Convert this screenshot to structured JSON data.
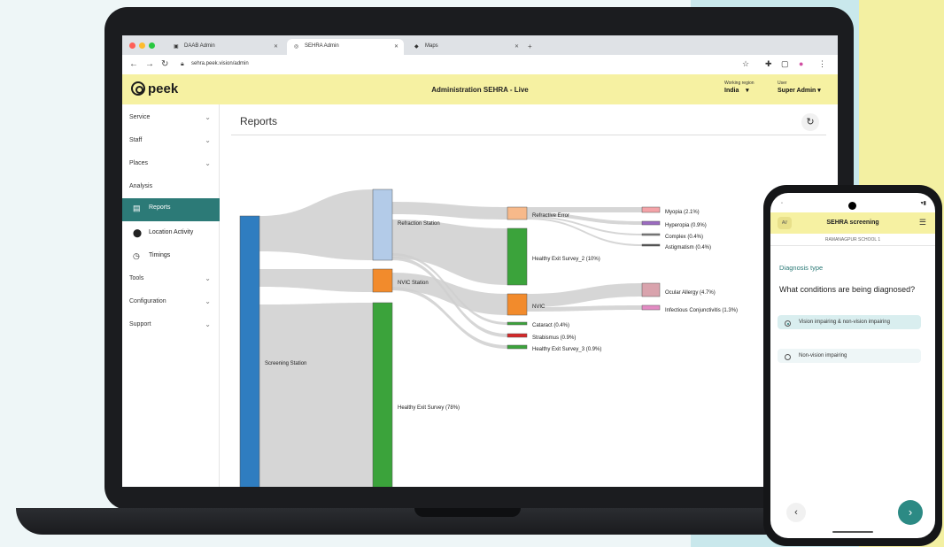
{
  "browser": {
    "tabs": [
      {
        "label": "DAAB Admin",
        "icon": "tab-favicon"
      },
      {
        "label": "SEHRA Admin",
        "icon": "peek-favicon"
      },
      {
        "label": "Maps",
        "icon": "figma-favicon"
      }
    ],
    "url": "sehra.peek.vision/admin"
  },
  "header": {
    "logo": "peek",
    "title": "Administration SEHRA - Live",
    "region_label": "Working region",
    "region_value": "India",
    "user_label": "User",
    "user_value": "Super Admin"
  },
  "sidebar": {
    "items": [
      {
        "label": "Service",
        "expandable": true
      },
      {
        "label": "Staff",
        "expandable": true
      },
      {
        "label": "Places",
        "expandable": true
      },
      {
        "label": "Analysis",
        "expandable": false
      },
      {
        "label": "Reports",
        "icon": "report-icon",
        "active": true
      },
      {
        "label": "Location Activity",
        "icon": "pin-icon"
      },
      {
        "label": "Timings",
        "icon": "timer-icon"
      },
      {
        "label": "Tools",
        "expandable": true
      },
      {
        "label": "Configuration",
        "expandable": true
      },
      {
        "label": "Support",
        "expandable": true
      }
    ]
  },
  "main": {
    "title": "Reports"
  },
  "chart_data": {
    "type": "sankey",
    "nodes": [
      {
        "id": "screening",
        "label": "Screening Station",
        "color": "#2f7dc0"
      },
      {
        "id": "refraction",
        "label": "Refraction Station",
        "color": "#b3cbe8"
      },
      {
        "id": "nvic",
        "label": "NVIC Station",
        "color": "#f28b2c"
      },
      {
        "id": "healthy",
        "label": "Healthy Exit Survey (78%)",
        "color": "#3ba33b"
      },
      {
        "id": "referr",
        "label": "Refractive Error",
        "color": "#f7b98a"
      },
      {
        "id": "healthy2",
        "label": "Healthy Exit Survey_2 (10%)",
        "color": "#3ba33b"
      },
      {
        "id": "nvic2",
        "label": "NVIC",
        "color": "#f28b2c"
      },
      {
        "id": "cataract",
        "label": "Cataract (0.4%)",
        "color": "#3ba33b"
      },
      {
        "id": "strab",
        "label": "Strabismus (0.9%)",
        "color": "#d62728"
      },
      {
        "id": "healthy3",
        "label": "Healthy Exit Survey_3 (0.9%)",
        "color": "#3ba33b"
      },
      {
        "id": "myopia",
        "label": "Myopia (2.1%)",
        "color": "#f4a3a8"
      },
      {
        "id": "hyperopia",
        "label": "Hyperopia (0.9%)",
        "color": "#9b6bc0"
      },
      {
        "id": "complex",
        "label": "Complex (0.4%)",
        "color": "#7f7f7f"
      },
      {
        "id": "astig",
        "label": "Astigmatism (0.4%)",
        "color": "#555555"
      },
      {
        "id": "allergy",
        "label": "Ocular Allergy (4.7%)",
        "color": "#d9a3ad"
      },
      {
        "id": "conj",
        "label": "Infectious Conjunctivitis (1.3%)",
        "color": "#e38bc3"
      }
    ]
  },
  "phone": {
    "avatar": "AV",
    "title": "SEHRA screening",
    "school": "RAMANAGPUR SCHOOL 1",
    "section": "Diagnosis type",
    "question": "What conditions are being diagnosed?",
    "options": [
      {
        "label": "Vision impairing & non-vision impairing",
        "selected": true
      },
      {
        "label": "Non-vision impairing",
        "selected": false
      }
    ]
  }
}
